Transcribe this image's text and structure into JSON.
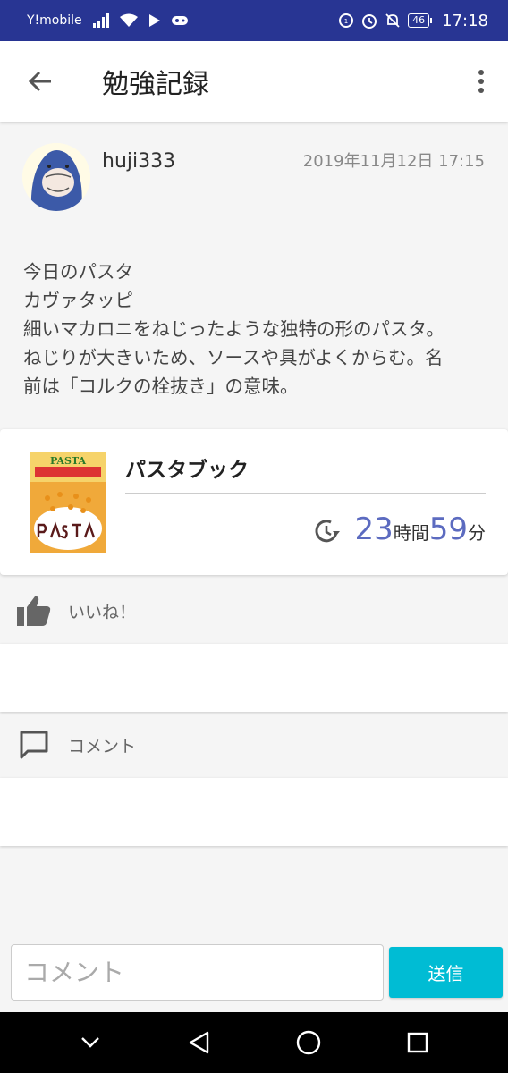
{
  "status_bar": {
    "carrier": "Y!mobile",
    "battery": "46",
    "time": "17:18"
  },
  "app_bar": {
    "title": "勉強記録",
    "back_icon": "arrow-back-icon",
    "menu_icon": "more-vert-icon"
  },
  "post": {
    "username": "huji333",
    "date": "2019年11月12日 17:15",
    "body_lines": [
      "今日のパスタ",
      "カヴァタッピ",
      "細いマカロニをねじったような独特の形のパスタ。",
      "ねじりが大きいため、ソースや具がよくからむ。名",
      "前は「コルクの栓抜き」の意味。"
    ]
  },
  "book": {
    "title": "パスタブック",
    "cover_text": "PASTA",
    "hours": "23",
    "hours_unit": "時間",
    "minutes": "59",
    "minutes_unit": "分"
  },
  "like": {
    "label": "いいね！"
  },
  "comments": {
    "label": "コメント"
  },
  "input": {
    "placeholder": "コメント",
    "value": "",
    "send_label": "送信"
  },
  "colors": {
    "status_bar": "#283593",
    "accent": "#5c6bc0",
    "send_button": "#00bcd4"
  }
}
